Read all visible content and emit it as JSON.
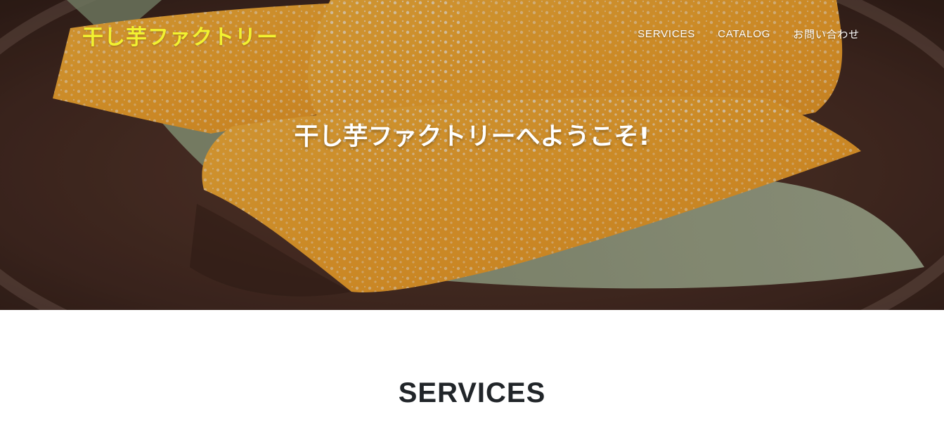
{
  "brand": {
    "title": "干し芋ファクトリー",
    "color": "#f2f230"
  },
  "nav": {
    "items": [
      {
        "label": "SERVICES"
      },
      {
        "label": "CATALOG"
      },
      {
        "label": "お問い合わせ"
      }
    ]
  },
  "hero": {
    "heading": "干し芋ファクトリーへようこそ!",
    "image": "dried-sweet-potato-photo"
  },
  "services": {
    "heading": "SERVICES"
  },
  "colors": {
    "nav_text": "#ffffff",
    "heading_text": "#212529",
    "page_background": "#ffffff"
  }
}
